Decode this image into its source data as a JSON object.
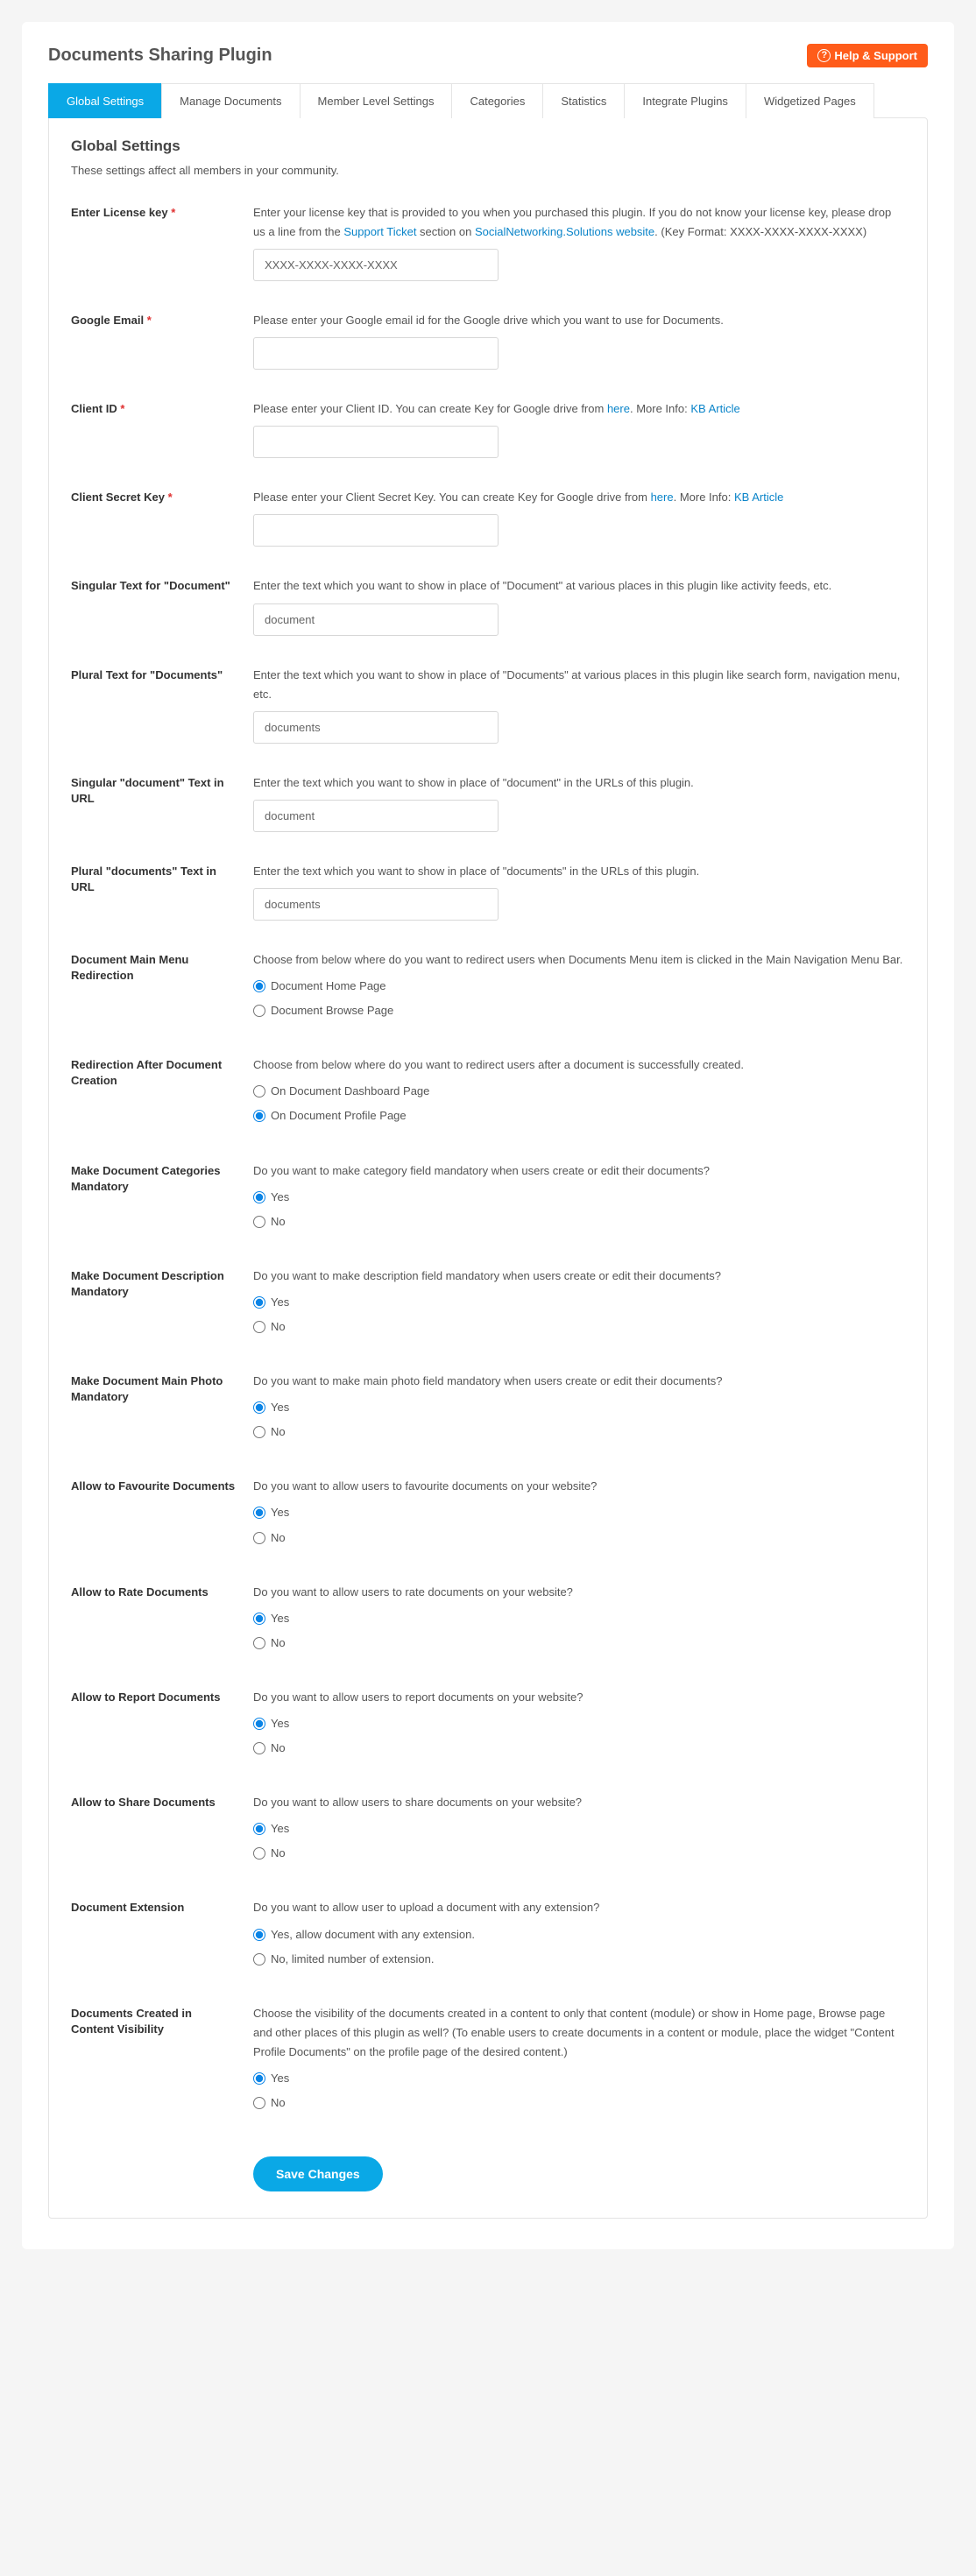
{
  "header": {
    "title": "Documents Sharing Plugin",
    "help_label": "Help & Support"
  },
  "tabs": [
    "Global Settings",
    "Manage Documents",
    "Member Level Settings",
    "Categories",
    "Statistics",
    "Integrate Plugins",
    "Widgetized Pages"
  ],
  "panel": {
    "title": "Global Settings",
    "subtitle": "These settings affect all members in your community.",
    "save_label": "Save Changes"
  },
  "f": {
    "license": {
      "label": "Enter License key",
      "desc1": "Enter your license key that is provided to you when you purchased this plugin. If you do not know your license key, please drop us a line from the ",
      "link1": "Support Ticket",
      "desc2": " section on ",
      "link2": "SocialNetworking.Solutions website",
      "desc3": ". (Key Format: XXXX-XXXX-XXXX-XXXX)",
      "value": "XXXX-XXXX-XXXX-XXXX"
    },
    "gemail": {
      "label": "Google Email",
      "desc": "Please enter your Google email id for the Google drive which you want to use for Documents."
    },
    "clientid": {
      "label": "Client ID",
      "desc1": "Please enter your Client ID. You can create Key for Google drive from ",
      "link1": "here",
      "desc2": ". More Info: ",
      "link2": "KB Article"
    },
    "secret": {
      "label": "Client Secret Key",
      "desc1": "Please enter your Client Secret Key. You can create Key for Google drive from ",
      "link1": "here",
      "desc2": ". More Info: ",
      "link2": "KB Article"
    },
    "singular": {
      "label": "Singular Text for \"Document\"",
      "desc": "Enter the text which you want to show in place of \"Document\" at various places in this plugin like activity feeds, etc.",
      "value": "document"
    },
    "plural": {
      "label": "Plural Text for \"Documents\"",
      "desc": "Enter the text which you want to show in place of \"Documents\" at various places in this plugin like search form, navigation menu, etc.",
      "value": "documents"
    },
    "urlsing": {
      "label": "Singular \"document\" Text in URL",
      "desc": "Enter the text which you want to show in place of \"document\" in the URLs of this plugin.",
      "value": "document"
    },
    "urlplur": {
      "label": "Plural \"documents\" Text in URL",
      "desc": "Enter the text which you want to show in place of \"documents\" in the URLs of this plugin.",
      "value": "documents"
    },
    "menuredir": {
      "label": "Document Main Menu Redirection",
      "desc": "Choose from below where do you want to redirect users when Documents Menu item is clicked in the Main Navigation Menu Bar.",
      "opt1": "Document Home Page",
      "opt2": "Document Browse Page"
    },
    "createredir": {
      "label": "Redirection After Document Creation",
      "desc": "Choose from below where do you want to redirect users after a document is successfully created.",
      "opt1": "On Document Dashboard Page",
      "opt2": "On Document Profile Page"
    },
    "catmand": {
      "label": "Make Document Categories Mandatory",
      "desc": "Do you want to make category field mandatory when users create or edit their documents?"
    },
    "descmand": {
      "label": "Make Document Description Mandatory",
      "desc": "Do you want to make description field mandatory when users create or edit their documents?"
    },
    "photomand": {
      "label": "Make Document Main Photo Mandatory",
      "desc": "Do you want to make main photo field mandatory when users create or edit their documents?"
    },
    "fav": {
      "label": "Allow to Favourite Documents",
      "desc": "Do you want to allow users to favourite documents on your website?"
    },
    "rate": {
      "label": "Allow to Rate Documents",
      "desc": "Do you want to allow users to rate documents on your website?"
    },
    "report": {
      "label": "Allow to Report Documents",
      "desc": "Do you want to allow users to report documents on your website?"
    },
    "share": {
      "label": "Allow to Share Documents",
      "desc": "Do you want to allow users to share documents on your website?"
    },
    "ext": {
      "label": "Document Extension",
      "desc": "Do you want to allow user to upload a document with any extension?",
      "opt1": "Yes, allow document with any extension.",
      "opt2": "No, limited number of extension."
    },
    "visibility": {
      "label": "Documents Created in Content Visibility",
      "desc": "Choose the visibility of the documents created in a content to only that content (module) or show in Home page, Browse page and other places of this plugin as well? (To enable users to create documents in a content or module, place the widget \"Content Profile Documents\" on the profile page of the desired content.)"
    },
    "yes": "Yes",
    "no": "No"
  }
}
